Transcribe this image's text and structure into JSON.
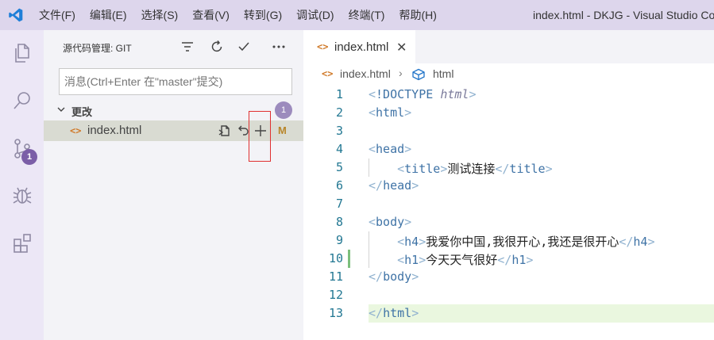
{
  "titlebar": {
    "menu": [
      "文件(F)",
      "编辑(E)",
      "选择(S)",
      "查看(V)",
      "转到(G)",
      "调试(D)",
      "终端(T)",
      "帮助(H)"
    ],
    "window_title": "index.html - DKJG - Visual Studio Co"
  },
  "activitybar": {
    "scm_badge": "1"
  },
  "sidebar": {
    "title": "源代码管理: GIT",
    "commit_placeholder": "消息(Ctrl+Enter 在\"master\"提交)",
    "changes_label": "更改",
    "changes_count": "1",
    "file": {
      "icon": "<>",
      "name": "index.html",
      "status": "M"
    }
  },
  "editor": {
    "tab": {
      "icon": "<>",
      "label": "index.html",
      "close": "✕"
    },
    "breadcrumb": {
      "icon": "<>",
      "file": "index.html",
      "sep": "›",
      "element": "html"
    },
    "lines": [
      {
        "n": "1",
        "parts": [
          [
            "t-br",
            "<"
          ],
          [
            "t-doc",
            "!DOCTYPE "
          ],
          [
            "t-doctype",
            "html"
          ],
          [
            "t-br",
            ">"
          ]
        ]
      },
      {
        "n": "2",
        "parts": [
          [
            "t-br",
            "<"
          ],
          [
            "t-tag",
            "html"
          ],
          [
            "t-br",
            ">"
          ]
        ]
      },
      {
        "n": "3",
        "parts": []
      },
      {
        "n": "4",
        "parts": [
          [
            "t-br",
            "<"
          ],
          [
            "t-tag",
            "head"
          ],
          [
            "t-br",
            ">"
          ]
        ]
      },
      {
        "n": "5",
        "parts": [
          [
            "t-text",
            "    "
          ],
          [
            "t-br",
            "<"
          ],
          [
            "t-tag",
            "title"
          ],
          [
            "t-br",
            ">"
          ],
          [
            "t-text",
            "测试连接"
          ],
          [
            "t-br",
            "</"
          ],
          [
            "t-tag",
            "title"
          ],
          [
            "t-br",
            ">"
          ]
        ]
      },
      {
        "n": "6",
        "parts": [
          [
            "t-br",
            "</"
          ],
          [
            "t-tag",
            "head"
          ],
          [
            "t-br",
            ">"
          ]
        ]
      },
      {
        "n": "7",
        "parts": []
      },
      {
        "n": "8",
        "parts": [
          [
            "t-br",
            "<"
          ],
          [
            "t-tag",
            "body"
          ],
          [
            "t-br",
            ">"
          ]
        ]
      },
      {
        "n": "9",
        "parts": [
          [
            "t-text",
            "    "
          ],
          [
            "t-br",
            "<"
          ],
          [
            "t-tag",
            "h4"
          ],
          [
            "t-br",
            ">"
          ],
          [
            "t-text",
            "我爱你中国,我很开心,我还是很开心"
          ],
          [
            "t-br",
            "</"
          ],
          [
            "t-tag",
            "h4"
          ],
          [
            "t-br",
            ">"
          ]
        ]
      },
      {
        "n": "10",
        "parts": [
          [
            "t-text",
            "    "
          ],
          [
            "t-br",
            "<"
          ],
          [
            "t-tag",
            "h1"
          ],
          [
            "t-br",
            ">"
          ],
          [
            "t-text",
            "今天天气很好"
          ],
          [
            "t-br",
            "</"
          ],
          [
            "t-tag",
            "h1"
          ],
          [
            "t-br",
            ">"
          ]
        ]
      },
      {
        "n": "11",
        "parts": [
          [
            "t-br",
            "</"
          ],
          [
            "t-tag",
            "body"
          ],
          [
            "t-br",
            ">"
          ]
        ]
      },
      {
        "n": "12",
        "parts": []
      },
      {
        "n": "13",
        "parts": [
          [
            "t-br",
            "</"
          ],
          [
            "t-tag",
            "html"
          ],
          [
            "t-br",
            ">"
          ]
        ]
      }
    ]
  }
}
